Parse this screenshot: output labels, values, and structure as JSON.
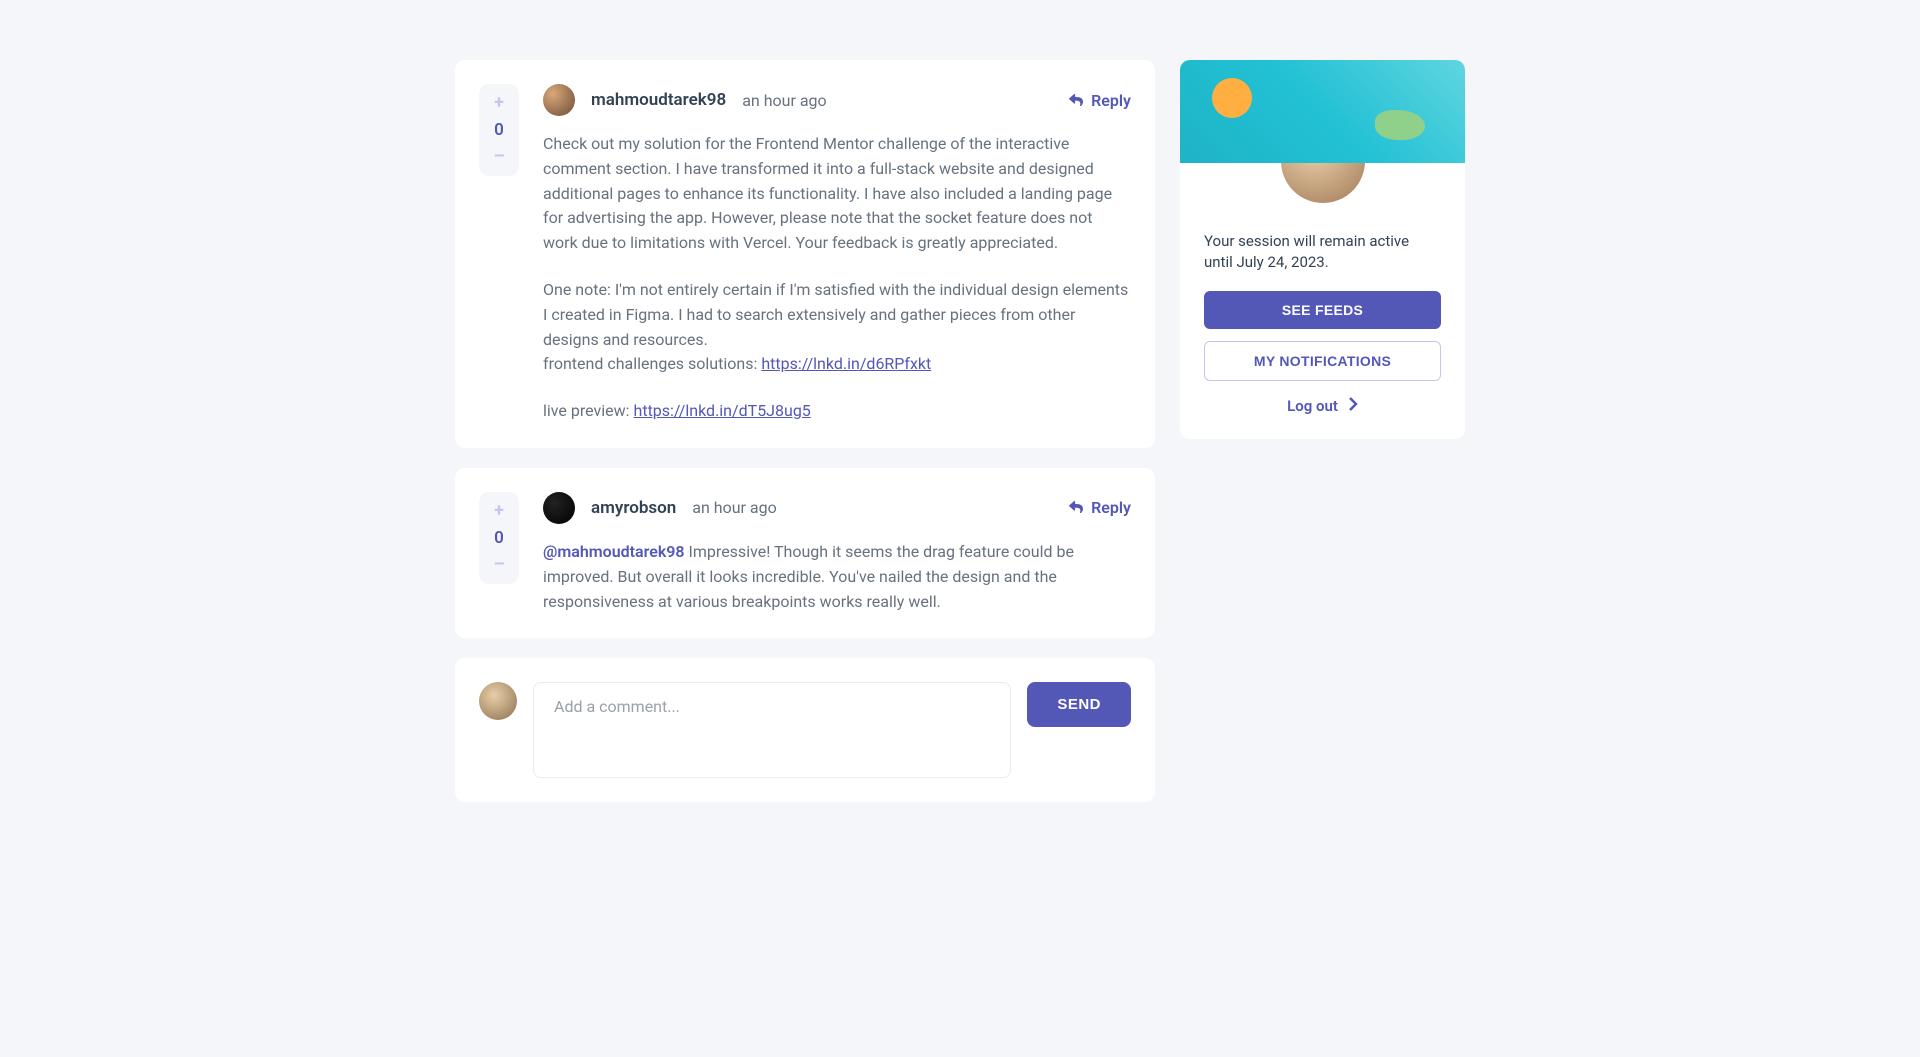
{
  "comments": [
    {
      "username": "mahmoudtarek98",
      "time": "an hour ago",
      "score": "0",
      "reply_label": "Reply",
      "body": {
        "p1": "Check out my solution for the Frontend Mentor challenge of the interactive comment section. I have transformed it into a full-stack website and designed additional pages to enhance its functionality. I have also included a landing page for advertising the app. However, please note that the socket feature does not work due to limitations with Vercel. Your feedback is greatly appreciated.",
        "p2_text": "One note: I'm not entirely certain if I'm satisfied with the individual design elements I created in Figma. I had to search extensively and gather pieces from other designs and resources.",
        "p2_label": "frontend challenges solutions: ",
        "p2_link": "https://lnkd.in/d6RPfxkt",
        "p3_label": "live preview: ",
        "p3_link": "https://lnkd.in/dT5J8ug5"
      }
    },
    {
      "username": "amyrobson",
      "time": "an hour ago",
      "score": "0",
      "reply_label": "Reply",
      "mention": "@mahmoudtarek98",
      "body_text": " Impressive! Though it seems the drag feature could be improved. But overall it looks incredible. You've nailed the design and the responsiveness at various breakpoints works really well."
    }
  ],
  "vote": {
    "plus": "+",
    "minus": "–"
  },
  "compose": {
    "placeholder": "Add a comment...",
    "send": "SEND"
  },
  "sidebar": {
    "session_text": "Your session will remain active until July 24, 2023.",
    "see_feeds": "SEE FEEDS",
    "notifications": "MY NOTIFICATIONS",
    "logout": "Log out"
  }
}
